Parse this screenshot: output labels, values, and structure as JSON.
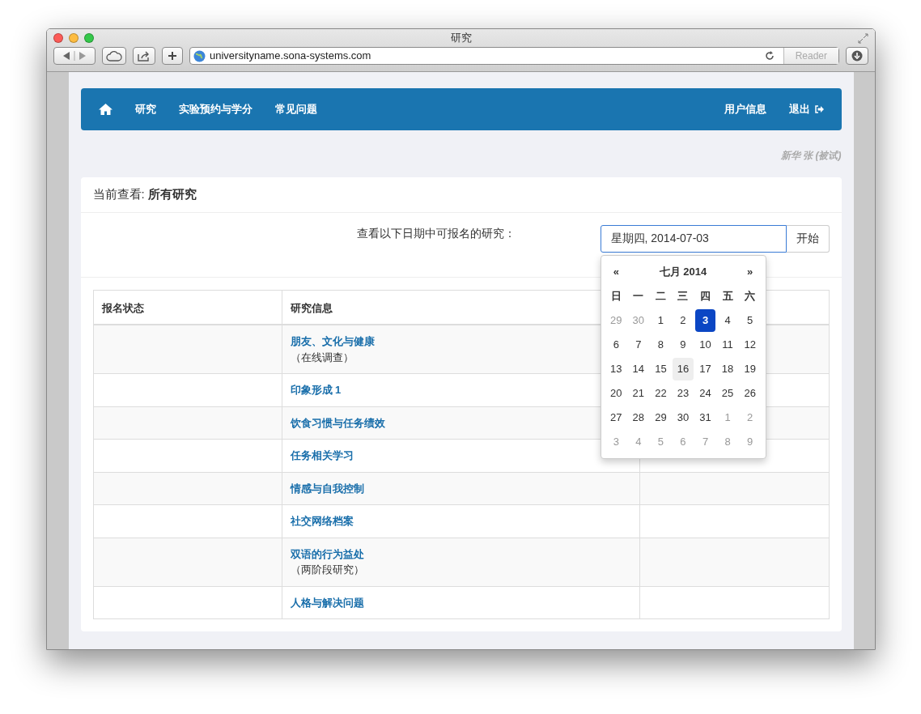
{
  "window": {
    "title": "研究",
    "url": "universityname.sona-systems.com",
    "reader": "Reader"
  },
  "navbar": {
    "left": [
      {
        "label": "研究"
      },
      {
        "label": "实验预约与学分"
      },
      {
        "label": "常见问题"
      }
    ],
    "right": [
      {
        "label": "用户信息",
        "kind": "plain"
      },
      {
        "label": "退出",
        "kind": "logout"
      }
    ]
  },
  "user": "新华 张 (被试)",
  "panel": {
    "heading_label": "当前查看:",
    "heading_value": "所有研究",
    "date_label": "查看以下日期中可报名的研究：",
    "date_value": "星期四, 2014-07-03",
    "go_button": "开始"
  },
  "calendar": {
    "prev": "«",
    "title": "七月 2014",
    "next": "»",
    "weekdays": [
      "日",
      "一",
      "二",
      "三",
      "四",
      "五",
      "六"
    ],
    "weeks": [
      [
        {
          "d": "29",
          "muted": true,
          "selected": false,
          "hovered": false
        },
        {
          "d": "30",
          "muted": true,
          "selected": false,
          "hovered": false
        },
        {
          "d": "1",
          "muted": false,
          "selected": false,
          "hovered": false
        },
        {
          "d": "2",
          "muted": false,
          "selected": false,
          "hovered": false
        },
        {
          "d": "3",
          "muted": false,
          "selected": true,
          "hovered": false
        },
        {
          "d": "4",
          "muted": false,
          "selected": false,
          "hovered": false
        },
        {
          "d": "5",
          "muted": false,
          "selected": false,
          "hovered": false
        }
      ],
      [
        {
          "d": "6",
          "muted": false,
          "selected": false,
          "hovered": false
        },
        {
          "d": "7",
          "muted": false,
          "selected": false,
          "hovered": false
        },
        {
          "d": "8",
          "muted": false,
          "selected": false,
          "hovered": false
        },
        {
          "d": "9",
          "muted": false,
          "selected": false,
          "hovered": false
        },
        {
          "d": "10",
          "muted": false,
          "selected": false,
          "hovered": false
        },
        {
          "d": "11",
          "muted": false,
          "selected": false,
          "hovered": false
        },
        {
          "d": "12",
          "muted": false,
          "selected": false,
          "hovered": false
        }
      ],
      [
        {
          "d": "13",
          "muted": false,
          "selected": false,
          "hovered": false
        },
        {
          "d": "14",
          "muted": false,
          "selected": false,
          "hovered": false
        },
        {
          "d": "15",
          "muted": false,
          "selected": false,
          "hovered": false
        },
        {
          "d": "16",
          "muted": false,
          "selected": false,
          "hovered": true
        },
        {
          "d": "17",
          "muted": false,
          "selected": false,
          "hovered": false
        },
        {
          "d": "18",
          "muted": false,
          "selected": false,
          "hovered": false
        },
        {
          "d": "19",
          "muted": false,
          "selected": false,
          "hovered": false
        }
      ],
      [
        {
          "d": "20",
          "muted": false,
          "selected": false,
          "hovered": false
        },
        {
          "d": "21",
          "muted": false,
          "selected": false,
          "hovered": false
        },
        {
          "d": "22",
          "muted": false,
          "selected": false,
          "hovered": false
        },
        {
          "d": "23",
          "muted": false,
          "selected": false,
          "hovered": false
        },
        {
          "d": "24",
          "muted": false,
          "selected": false,
          "hovered": false
        },
        {
          "d": "25",
          "muted": false,
          "selected": false,
          "hovered": false
        },
        {
          "d": "26",
          "muted": false,
          "selected": false,
          "hovered": false
        }
      ],
      [
        {
          "d": "27",
          "muted": false,
          "selected": false,
          "hovered": false
        },
        {
          "d": "28",
          "muted": false,
          "selected": false,
          "hovered": false
        },
        {
          "d": "29",
          "muted": false,
          "selected": false,
          "hovered": false
        },
        {
          "d": "30",
          "muted": false,
          "selected": false,
          "hovered": false
        },
        {
          "d": "31",
          "muted": false,
          "selected": false,
          "hovered": false
        },
        {
          "d": "1",
          "muted": true,
          "selected": false,
          "hovered": false
        },
        {
          "d": "2",
          "muted": true,
          "selected": false,
          "hovered": false
        }
      ],
      [
        {
          "d": "3",
          "muted": true,
          "selected": false,
          "hovered": false
        },
        {
          "d": "4",
          "muted": true,
          "selected": false,
          "hovered": false
        },
        {
          "d": "5",
          "muted": true,
          "selected": false,
          "hovered": false
        },
        {
          "d": "6",
          "muted": true,
          "selected": false,
          "hovered": false
        },
        {
          "d": "7",
          "muted": true,
          "selected": false,
          "hovered": false
        },
        {
          "d": "8",
          "muted": true,
          "selected": false,
          "hovered": false
        },
        {
          "d": "9",
          "muted": true,
          "selected": false,
          "hovered": false
        }
      ]
    ]
  },
  "table": {
    "columns": [
      "报名状态",
      "研究信息"
    ],
    "rows": [
      {
        "title": "朋友、文化与健康",
        "note": "（在线调查）"
      },
      {
        "title": "印象形成 1"
      },
      {
        "title": "饮食习惯与任务绩效"
      },
      {
        "title": "任务相关学习"
      },
      {
        "title": "情感与自我控制"
      },
      {
        "title": "社交网络档案"
      },
      {
        "title": "双语的行为益处",
        "note": "（两阶段研究）"
      },
      {
        "title": "人格与解决问题"
      }
    ]
  }
}
